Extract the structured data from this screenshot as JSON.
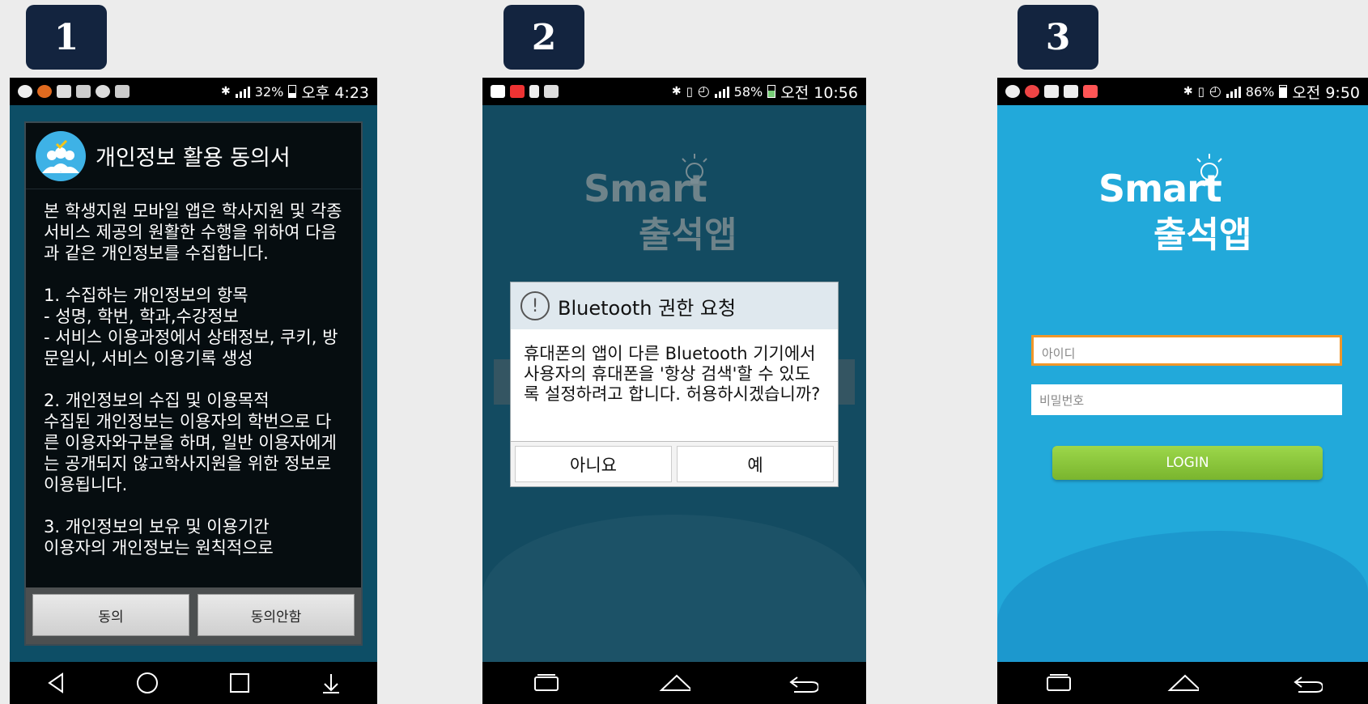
{
  "steps": [
    "1",
    "2",
    "3"
  ],
  "phone1": {
    "status": {
      "battery": "32%",
      "time": "오후 4:23"
    },
    "dialog": {
      "title": "개인정보 활용 동의서",
      "intro": "본 학생지원 모바일 앱은 학사지원 및 각종 서비스 제공의 원활한 수행을 위하여 다음과 같은 개인정보를 수집합니다.",
      "section1": [
        "1. 수집하는 개인정보의 항목",
        "- 성명, 학번, 학과,수강정보",
        "- 서비스 이용과정에서 상태정보, 쿠키, 방문일시, 서비스 이용기록 생성"
      ],
      "section2": [
        "2. 개인정보의 수집 및 이용목적",
        "수집된 개인정보는 이용자의 학번으로 다른 이용자와구분을 하며, 일반 이용자에게는 공개되지 않고학사지원을 위한 정보로 이용됩니다."
      ],
      "section3": [
        "3. 개인정보의 보유 및 이용기간",
        "이용자의 개인정보는 원칙적으로"
      ],
      "agree_label": "동의",
      "disagree_label": "동의안함"
    }
  },
  "phone2": {
    "status": {
      "battery": "58%",
      "time": "오전 10:56"
    },
    "logo": {
      "line1": "Smart",
      "line2": "출석앱"
    },
    "dialog": {
      "title": "Bluetooth 권한 요청",
      "message": "휴대폰의 앱이 다른 Bluetooth 기기에서 사용자의 휴대폰을 '항상 검색'할 수 있도록 설정하려고 합니다. 허용하시겠습니까?",
      "no_label": "아니요",
      "yes_label": "예"
    }
  },
  "phone3": {
    "status": {
      "battery": "86%",
      "time": "오전 9:50"
    },
    "logo": {
      "line1": "Smart",
      "line2": "출석앱"
    },
    "id_placeholder": "아이디",
    "pw_placeholder": "비밀번호",
    "login_label": "LOGIN"
  },
  "colors": {
    "badge": "#13243f",
    "login_green": "#8cc63f",
    "focus_orange": "#f0972a"
  },
  "icons": [
    "back-icon",
    "home-icon",
    "recents-icon",
    "notifications-icon"
  ]
}
